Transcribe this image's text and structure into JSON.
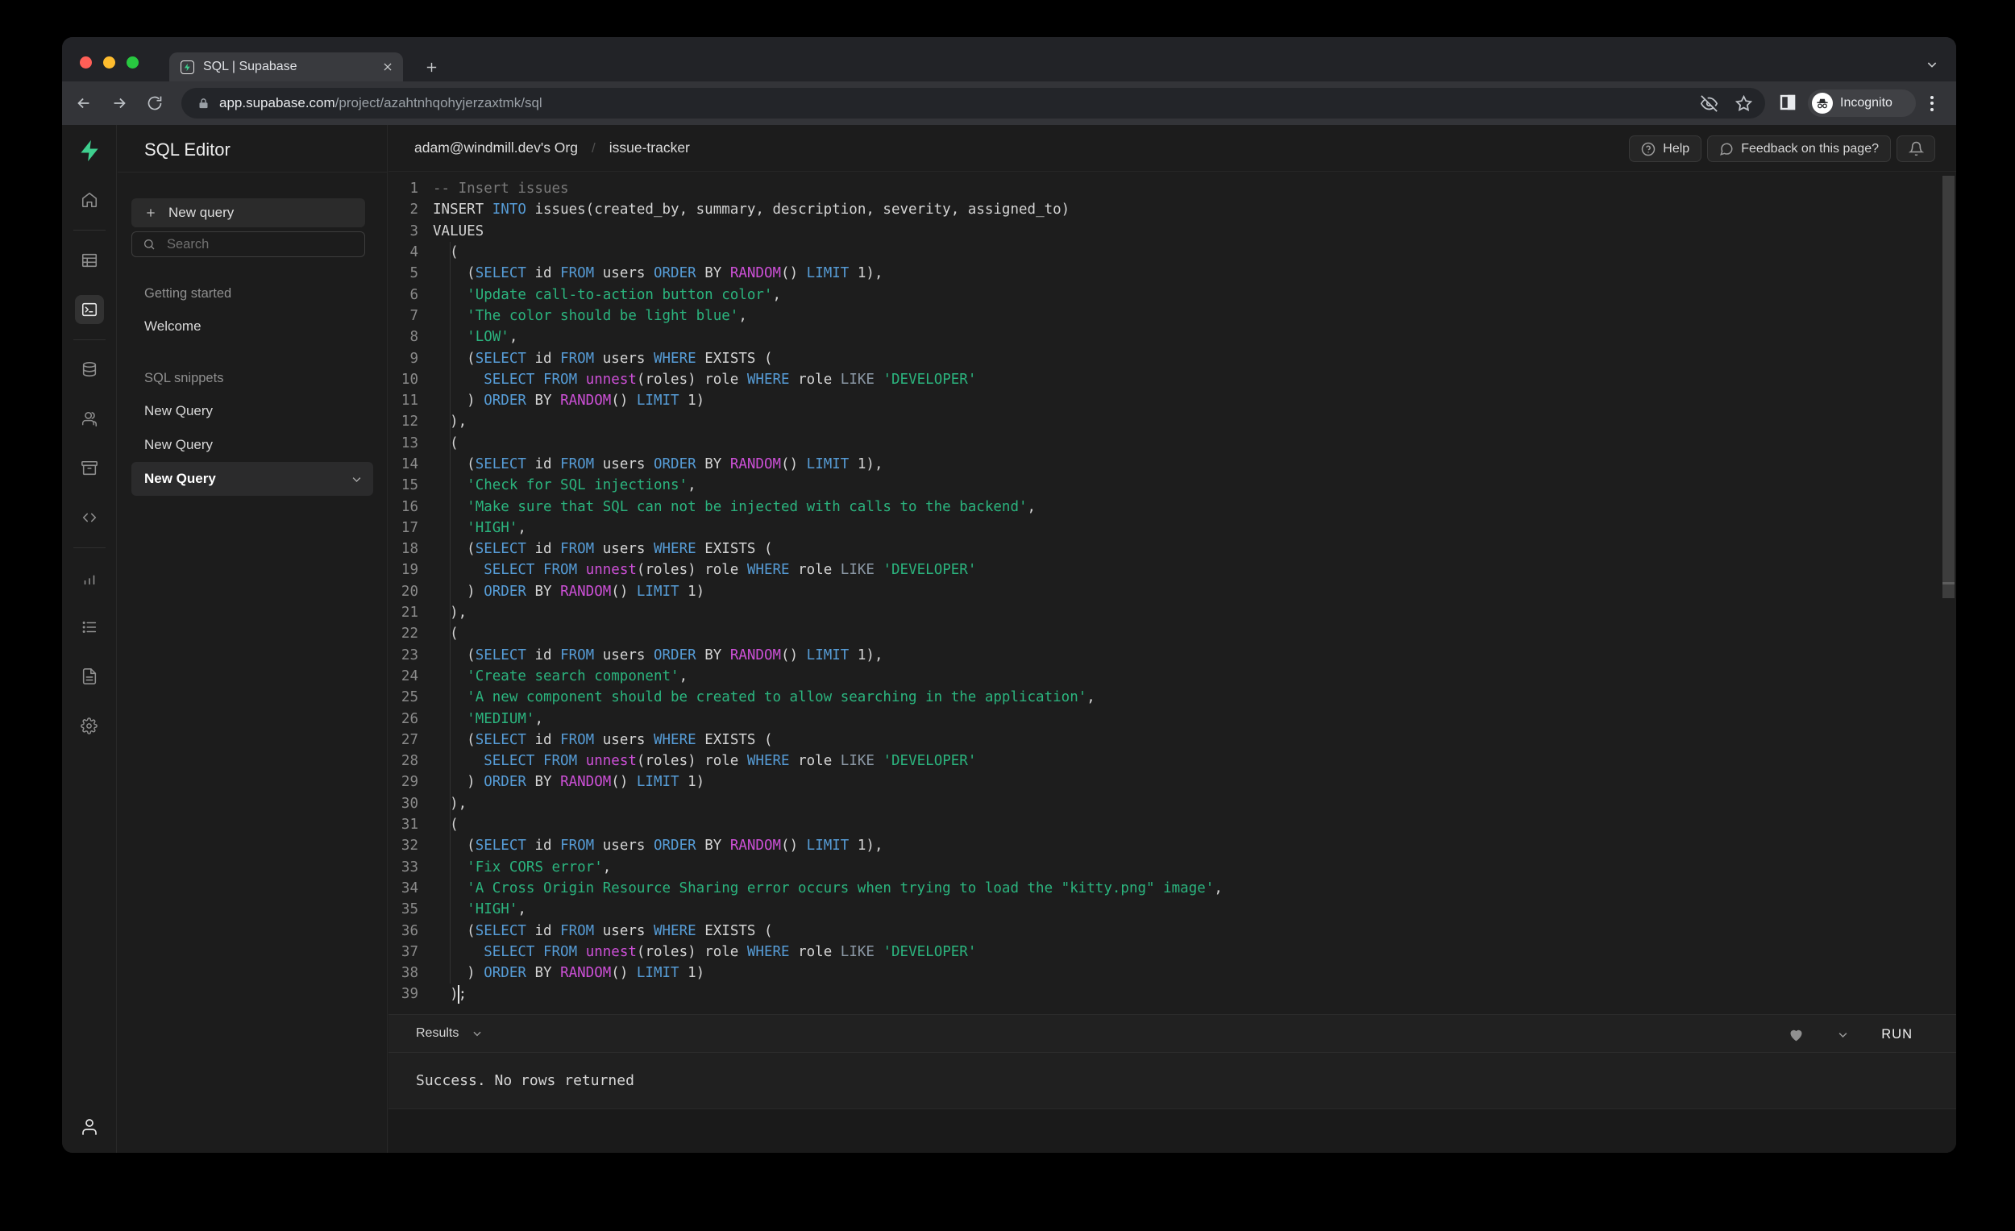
{
  "browser": {
    "tab_title": "SQL | Supabase",
    "url_host": "app.supabase.com",
    "url_path": "/project/azahtnhqohyjerzaxtmk/sql",
    "incognito_label": "Incognito"
  },
  "rail": {
    "items": [
      {
        "icon": "supabase-logo"
      },
      {
        "icon": "home"
      },
      {
        "divider": true
      },
      {
        "icon": "table-editor"
      },
      {
        "icon": "sql-editor",
        "active": true
      },
      {
        "divider": true
      },
      {
        "icon": "database"
      },
      {
        "icon": "auth"
      },
      {
        "icon": "storage"
      },
      {
        "icon": "code"
      },
      {
        "divider": true
      },
      {
        "icon": "reports"
      },
      {
        "icon": "logs"
      },
      {
        "icon": "docs"
      },
      {
        "icon": "settings"
      }
    ],
    "bottom_icon": "account"
  },
  "sidebar": {
    "title": "SQL Editor",
    "new_query_button": "New query",
    "search_placeholder": "Search",
    "sections": [
      {
        "label": "Getting started",
        "items": [
          {
            "label": "Welcome"
          }
        ]
      },
      {
        "label": "SQL snippets",
        "items": [
          {
            "label": "New Query"
          },
          {
            "label": "New Query"
          },
          {
            "label": "New Query",
            "selected": true
          }
        ]
      }
    ]
  },
  "header": {
    "breadcrumb": [
      "adam@windmill.dev's Org",
      "issue-tracker"
    ],
    "help_label": "Help",
    "feedback_label": "Feedback on this page?"
  },
  "editor": {
    "lines": [
      {
        "n": 1,
        "t": [
          [
            "c",
            "-- Insert issues"
          ]
        ]
      },
      {
        "n": 2,
        "t": [
          [
            "t",
            "INSERT "
          ],
          [
            "k",
            "INTO"
          ],
          [
            "t",
            " issues(created_by, summary, description, severity, assigned_to)"
          ]
        ]
      },
      {
        "n": 3,
        "t": [
          [
            "t",
            "VALUES"
          ]
        ]
      },
      {
        "n": 4,
        "t": [
          [
            "t",
            "  ("
          ]
        ]
      },
      {
        "n": 5,
        "t": [
          [
            "t",
            "    ("
          ],
          [
            "k",
            "SELECT"
          ],
          [
            "t",
            " id "
          ],
          [
            "k",
            "FROM"
          ],
          [
            "t",
            " users "
          ],
          [
            "k",
            "ORDER"
          ],
          [
            "t",
            " BY "
          ],
          [
            "f",
            "RANDOM"
          ],
          [
            "t",
            "() "
          ],
          [
            "k",
            "LIMIT"
          ],
          [
            "t",
            " 1),"
          ]
        ]
      },
      {
        "n": 6,
        "t": [
          [
            "t",
            "    "
          ],
          [
            "s",
            "'Update call-to-action button color'"
          ],
          [
            "t",
            ","
          ]
        ]
      },
      {
        "n": 7,
        "t": [
          [
            "t",
            "    "
          ],
          [
            "s",
            "'The color should be light blue'"
          ],
          [
            "t",
            ","
          ]
        ]
      },
      {
        "n": 8,
        "t": [
          [
            "t",
            "    "
          ],
          [
            "s",
            "'LOW'"
          ],
          [
            "t",
            ","
          ]
        ]
      },
      {
        "n": 9,
        "t": [
          [
            "t",
            "    ("
          ],
          [
            "k",
            "SELECT"
          ],
          [
            "t",
            " id "
          ],
          [
            "k",
            "FROM"
          ],
          [
            "t",
            " users "
          ],
          [
            "k",
            "WHERE"
          ],
          [
            "t",
            " EXISTS ("
          ]
        ]
      },
      {
        "n": 10,
        "t": [
          [
            "t",
            "      "
          ],
          [
            "k",
            "SELECT"
          ],
          [
            "t",
            " "
          ],
          [
            "k",
            "FROM"
          ],
          [
            "t",
            " "
          ],
          [
            "f",
            "unnest"
          ],
          [
            "t",
            "(roles) role "
          ],
          [
            "k",
            "WHERE"
          ],
          [
            "t",
            " role "
          ],
          [
            "o",
            "LIKE"
          ],
          [
            "t",
            " "
          ],
          [
            "s",
            "'DEVELOPER'"
          ]
        ]
      },
      {
        "n": 11,
        "t": [
          [
            "t",
            "    ) "
          ],
          [
            "k",
            "ORDER"
          ],
          [
            "t",
            " BY "
          ],
          [
            "f",
            "RANDOM"
          ],
          [
            "t",
            "() "
          ],
          [
            "k",
            "LIMIT"
          ],
          [
            "t",
            " 1)"
          ]
        ]
      },
      {
        "n": 12,
        "t": [
          [
            "t",
            "  ),"
          ]
        ]
      },
      {
        "n": 13,
        "t": [
          [
            "t",
            "  ("
          ]
        ]
      },
      {
        "n": 14,
        "t": [
          [
            "t",
            "    ("
          ],
          [
            "k",
            "SELECT"
          ],
          [
            "t",
            " id "
          ],
          [
            "k",
            "FROM"
          ],
          [
            "t",
            " users "
          ],
          [
            "k",
            "ORDER"
          ],
          [
            "t",
            " BY "
          ],
          [
            "f",
            "RANDOM"
          ],
          [
            "t",
            "() "
          ],
          [
            "k",
            "LIMIT"
          ],
          [
            "t",
            " 1),"
          ]
        ]
      },
      {
        "n": 15,
        "t": [
          [
            "t",
            "    "
          ],
          [
            "s",
            "'Check for SQL injections'"
          ],
          [
            "t",
            ","
          ]
        ]
      },
      {
        "n": 16,
        "t": [
          [
            "t",
            "    "
          ],
          [
            "s",
            "'Make sure that SQL can not be injected with calls to the backend'"
          ],
          [
            "t",
            ","
          ]
        ]
      },
      {
        "n": 17,
        "t": [
          [
            "t",
            "    "
          ],
          [
            "s",
            "'HIGH'"
          ],
          [
            "t",
            ","
          ]
        ]
      },
      {
        "n": 18,
        "t": [
          [
            "t",
            "    ("
          ],
          [
            "k",
            "SELECT"
          ],
          [
            "t",
            " id "
          ],
          [
            "k",
            "FROM"
          ],
          [
            "t",
            " users "
          ],
          [
            "k",
            "WHERE"
          ],
          [
            "t",
            " EXISTS ("
          ]
        ]
      },
      {
        "n": 19,
        "t": [
          [
            "t",
            "      "
          ],
          [
            "k",
            "SELECT"
          ],
          [
            "t",
            " "
          ],
          [
            "k",
            "FROM"
          ],
          [
            "t",
            " "
          ],
          [
            "f",
            "unnest"
          ],
          [
            "t",
            "(roles) role "
          ],
          [
            "k",
            "WHERE"
          ],
          [
            "t",
            " role "
          ],
          [
            "o",
            "LIKE"
          ],
          [
            "t",
            " "
          ],
          [
            "s",
            "'DEVELOPER'"
          ]
        ]
      },
      {
        "n": 20,
        "t": [
          [
            "t",
            "    ) "
          ],
          [
            "k",
            "ORDER"
          ],
          [
            "t",
            " BY "
          ],
          [
            "f",
            "RANDOM"
          ],
          [
            "t",
            "() "
          ],
          [
            "k",
            "LIMIT"
          ],
          [
            "t",
            " 1)"
          ]
        ]
      },
      {
        "n": 21,
        "t": [
          [
            "t",
            "  ),"
          ]
        ]
      },
      {
        "n": 22,
        "t": [
          [
            "t",
            "  ("
          ]
        ]
      },
      {
        "n": 23,
        "t": [
          [
            "t",
            "    ("
          ],
          [
            "k",
            "SELECT"
          ],
          [
            "t",
            " id "
          ],
          [
            "k",
            "FROM"
          ],
          [
            "t",
            " users "
          ],
          [
            "k",
            "ORDER"
          ],
          [
            "t",
            " BY "
          ],
          [
            "f",
            "RANDOM"
          ],
          [
            "t",
            "() "
          ],
          [
            "k",
            "LIMIT"
          ],
          [
            "t",
            " 1),"
          ]
        ]
      },
      {
        "n": 24,
        "t": [
          [
            "t",
            "    "
          ],
          [
            "s",
            "'Create search component'"
          ],
          [
            "t",
            ","
          ]
        ]
      },
      {
        "n": 25,
        "t": [
          [
            "t",
            "    "
          ],
          [
            "s",
            "'A new component should be created to allow searching in the application'"
          ],
          [
            "t",
            ","
          ]
        ]
      },
      {
        "n": 26,
        "t": [
          [
            "t",
            "    "
          ],
          [
            "s",
            "'MEDIUM'"
          ],
          [
            "t",
            ","
          ]
        ]
      },
      {
        "n": 27,
        "t": [
          [
            "t",
            "    ("
          ],
          [
            "k",
            "SELECT"
          ],
          [
            "t",
            " id "
          ],
          [
            "k",
            "FROM"
          ],
          [
            "t",
            " users "
          ],
          [
            "k",
            "WHERE"
          ],
          [
            "t",
            " EXISTS ("
          ]
        ]
      },
      {
        "n": 28,
        "t": [
          [
            "t",
            "      "
          ],
          [
            "k",
            "SELECT"
          ],
          [
            "t",
            " "
          ],
          [
            "k",
            "FROM"
          ],
          [
            "t",
            " "
          ],
          [
            "f",
            "unnest"
          ],
          [
            "t",
            "(roles) role "
          ],
          [
            "k",
            "WHERE"
          ],
          [
            "t",
            " role "
          ],
          [
            "o",
            "LIKE"
          ],
          [
            "t",
            " "
          ],
          [
            "s",
            "'DEVELOPER'"
          ]
        ]
      },
      {
        "n": 29,
        "t": [
          [
            "t",
            "    ) "
          ],
          [
            "k",
            "ORDER"
          ],
          [
            "t",
            " BY "
          ],
          [
            "f",
            "RANDOM"
          ],
          [
            "t",
            "() "
          ],
          [
            "k",
            "LIMIT"
          ],
          [
            "t",
            " 1)"
          ]
        ]
      },
      {
        "n": 30,
        "t": [
          [
            "t",
            "  ),"
          ]
        ]
      },
      {
        "n": 31,
        "t": [
          [
            "t",
            "  ("
          ]
        ]
      },
      {
        "n": 32,
        "t": [
          [
            "t",
            "    ("
          ],
          [
            "k",
            "SELECT"
          ],
          [
            "t",
            " id "
          ],
          [
            "k",
            "FROM"
          ],
          [
            "t",
            " users "
          ],
          [
            "k",
            "ORDER"
          ],
          [
            "t",
            " BY "
          ],
          [
            "f",
            "RANDOM"
          ],
          [
            "t",
            "() "
          ],
          [
            "k",
            "LIMIT"
          ],
          [
            "t",
            " 1),"
          ]
        ]
      },
      {
        "n": 33,
        "t": [
          [
            "t",
            "    "
          ],
          [
            "s",
            "'Fix CORS error'"
          ],
          [
            "t",
            ","
          ]
        ]
      },
      {
        "n": 34,
        "t": [
          [
            "t",
            "    "
          ],
          [
            "s",
            "'A Cross Origin Resource Sharing error occurs when trying to load the \"kitty.png\" image'"
          ],
          [
            "t",
            ","
          ]
        ]
      },
      {
        "n": 35,
        "t": [
          [
            "t",
            "    "
          ],
          [
            "s",
            "'HIGH'"
          ],
          [
            "t",
            ","
          ]
        ]
      },
      {
        "n": 36,
        "t": [
          [
            "t",
            "    ("
          ],
          [
            "k",
            "SELECT"
          ],
          [
            "t",
            " id "
          ],
          [
            "k",
            "FROM"
          ],
          [
            "t",
            " users "
          ],
          [
            "k",
            "WHERE"
          ],
          [
            "t",
            " EXISTS ("
          ]
        ]
      },
      {
        "n": 37,
        "t": [
          [
            "t",
            "      "
          ],
          [
            "k",
            "SELECT"
          ],
          [
            "t",
            " "
          ],
          [
            "k",
            "FROM"
          ],
          [
            "t",
            " "
          ],
          [
            "f",
            "unnest"
          ],
          [
            "t",
            "(roles) role "
          ],
          [
            "k",
            "WHERE"
          ],
          [
            "t",
            " role "
          ],
          [
            "o",
            "LIKE"
          ],
          [
            "t",
            " "
          ],
          [
            "s",
            "'DEVELOPER'"
          ]
        ]
      },
      {
        "n": 38,
        "t": [
          [
            "t",
            "    ) "
          ],
          [
            "k",
            "ORDER"
          ],
          [
            "t",
            " BY "
          ],
          [
            "f",
            "RANDOM"
          ],
          [
            "t",
            "() "
          ],
          [
            "k",
            "LIMIT"
          ],
          [
            "t",
            " 1)"
          ]
        ]
      },
      {
        "n": 39,
        "t": [
          [
            "t",
            "  )"
          ],
          [
            "cur",
            ""
          ],
          [
            "t",
            ";"
          ]
        ]
      }
    ]
  },
  "results": {
    "label": "Results",
    "run_label": "RUN",
    "message": "Success. No rows returned"
  },
  "colors": {
    "accent_green": "#3ecf8e",
    "keyword": "#569cd6",
    "function": "#cd50d7",
    "string": "#2bb47e",
    "comment": "#7a7a7a",
    "app_bg": "#1c1c1c"
  }
}
